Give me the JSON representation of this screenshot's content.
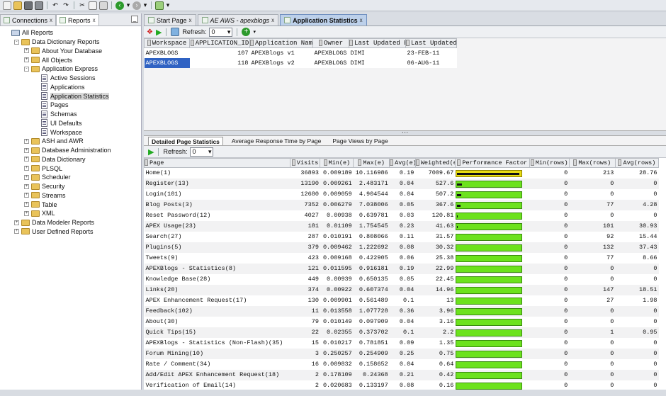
{
  "left_panel": {
    "tabs": [
      {
        "label": "Connections",
        "close": "x"
      },
      {
        "label": "Reports",
        "close": "x"
      }
    ],
    "minimize": "_",
    "tree": [
      {
        "label": "All Reports",
        "level": 0,
        "icon": "report-folder-icon",
        "expander": ""
      },
      {
        "label": "Data Dictionary Reports",
        "level": 1,
        "icon": "folder-icon",
        "expander": "-"
      },
      {
        "label": "About Your Database",
        "level": 2,
        "icon": "folder-icon",
        "expander": "+"
      },
      {
        "label": "All Objects",
        "level": 2,
        "icon": "folder-icon",
        "expander": "+"
      },
      {
        "label": "Application Express",
        "level": 2,
        "icon": "folder-icon",
        "expander": "-"
      },
      {
        "label": "Active Sessions",
        "level": 3,
        "icon": "report-icon",
        "expander": ""
      },
      {
        "label": "Applications",
        "level": 3,
        "icon": "report-icon",
        "expander": ""
      },
      {
        "label": "Application Statistics",
        "level": 3,
        "icon": "report-icon",
        "expander": "",
        "selected": true
      },
      {
        "label": "Pages",
        "level": 3,
        "icon": "report-icon",
        "expander": ""
      },
      {
        "label": "Schemas",
        "level": 3,
        "icon": "report-icon",
        "expander": ""
      },
      {
        "label": "UI Defaults",
        "level": 3,
        "icon": "report-icon",
        "expander": ""
      },
      {
        "label": "Workspace",
        "level": 3,
        "icon": "report-icon",
        "expander": ""
      },
      {
        "label": "ASH and AWR",
        "level": 2,
        "icon": "folder-icon",
        "expander": "+"
      },
      {
        "label": "Database Administration",
        "level": 2,
        "icon": "folder-icon",
        "expander": "+"
      },
      {
        "label": "Data Dictionary",
        "level": 2,
        "icon": "folder-icon",
        "expander": "+"
      },
      {
        "label": "PLSQL",
        "level": 2,
        "icon": "folder-icon",
        "expander": "+"
      },
      {
        "label": "Scheduler",
        "level": 2,
        "icon": "folder-icon",
        "expander": "+"
      },
      {
        "label": "Security",
        "level": 2,
        "icon": "folder-icon",
        "expander": "+"
      },
      {
        "label": "Streams",
        "level": 2,
        "icon": "folder-icon",
        "expander": "+"
      },
      {
        "label": "Table",
        "level": 2,
        "icon": "folder-icon",
        "expander": "+"
      },
      {
        "label": "XML",
        "level": 2,
        "icon": "folder-icon",
        "expander": "+"
      },
      {
        "label": "Data Modeler Reports",
        "level": 1,
        "icon": "folder-icon",
        "expander": "+"
      },
      {
        "label": "User Defined Reports",
        "level": 1,
        "icon": "folder-icon",
        "expander": "+"
      }
    ]
  },
  "editor": {
    "tabs": [
      {
        "label": "Start Page",
        "close": "x"
      },
      {
        "label": "AE AWS - apexblogs",
        "close": "x"
      },
      {
        "label": "Application Statistics",
        "close": "x",
        "selected": true
      }
    ],
    "refresh_label": "Refresh:",
    "refresh_value": "0",
    "apps_table": {
      "columns": [
        "Workspace",
        "APPLICATION_ID",
        "Application Name",
        "Owner",
        "Last Updated By",
        "Last Updated"
      ],
      "rows": [
        [
          "APEXBLOGS",
          "107",
          "APEXBlogs v1",
          "APEXBLOGS",
          "DIMI",
          "23-FEB-11"
        ],
        [
          "APEXBLOGS",
          "118",
          "APEXBlogs v2",
          "APEXBLOGS",
          "DIMI",
          "06-AUG-11"
        ]
      ]
    },
    "subtabs": [
      "Detailed Page Statistics",
      "Average Response Time by Page",
      "Page Views by Page"
    ],
    "detail_refresh_label": "Refresh:",
    "detail_refresh_value": "0",
    "detail_table": {
      "columns": [
        "Page",
        "Visits",
        "Min(e)",
        "Max(e)",
        "Avg(e)",
        "Weighted(e)",
        "Performance Factor",
        "Min(rows)",
        "Max(rows)",
        "Avg(rows)"
      ],
      "rows": [
        [
          "Home(1)",
          "36893",
          "0.009189",
          "10.116986",
          "0.19",
          "7009.67",
          1.0,
          "0",
          "213",
          "28.76"
        ],
        [
          "Register(13)",
          "13190",
          "0.009261",
          "2.483171",
          "0.04",
          "527.6",
          0.075,
          "0",
          "0",
          "0"
        ],
        [
          "Login(101)",
          "12680",
          "0.009059",
          "4.904544",
          "0.04",
          "507.2",
          0.072,
          "0",
          "0",
          "0"
        ],
        [
          "Blog Posts(3)",
          "7352",
          "0.006279",
          "7.038006",
          "0.05",
          "367.6",
          0.052,
          "0",
          "77",
          "4.28"
        ],
        [
          "Reset Password(12)",
          "4027",
          "0.00938",
          "0.639781",
          "0.03",
          "120.81",
          0.017,
          "0",
          "0",
          "0"
        ],
        [
          "APEX Usage(23)",
          "181",
          "0.01109",
          "1.754545",
          "0.23",
          "41.63",
          0.006,
          "0",
          "101",
          "30.93"
        ],
        [
          "Search(27)",
          "287",
          "0.010191",
          "0.808066",
          "0.11",
          "31.57",
          0.0045,
          "0",
          "92",
          "15.44"
        ],
        [
          "Plugins(5)",
          "379",
          "0.009462",
          "1.222692",
          "0.08",
          "30.32",
          0.0043,
          "0",
          "132",
          "37.43"
        ],
        [
          "Tweets(9)",
          "423",
          "0.009168",
          "0.422905",
          "0.06",
          "25.38",
          0.0036,
          "0",
          "77",
          "8.66"
        ],
        [
          "APEXBlogs - Statistics(8)",
          "121",
          "0.011595",
          "0.916181",
          "0.19",
          "22.99",
          0.0033,
          "0",
          "0",
          "0"
        ],
        [
          "Knowledge Base(28)",
          "449",
          "0.00939",
          "0.650135",
          "0.05",
          "22.45",
          0.0032,
          "0",
          "0",
          "0"
        ],
        [
          "Links(20)",
          "374",
          "0.00922",
          "0.607374",
          "0.04",
          "14.96",
          0.0021,
          "0",
          "147",
          "18.51"
        ],
        [
          "APEX Enhancement Request(17)",
          "130",
          "0.009901",
          "0.561489",
          "0.1",
          "13",
          0.0019,
          "0",
          "27",
          "1.98"
        ],
        [
          "Feedback(102)",
          "11",
          "0.013558",
          "1.077728",
          "0.36",
          "3.96",
          0.0006,
          "0",
          "0",
          "0"
        ],
        [
          "About(30)",
          "79",
          "0.010149",
          "0.097909",
          "0.04",
          "3.16",
          0.0005,
          "0",
          "0",
          "0"
        ],
        [
          "Quick Tips(15)",
          "22",
          "0.02355",
          "0.373702",
          "0.1",
          "2.2",
          0.0003,
          "0",
          "1",
          "0.95"
        ],
        [
          "APEXBlogs - Statistics (Non-Flash)(35)",
          "15",
          "0.010217",
          "0.781851",
          "0.09",
          "1.35",
          0.0002,
          "0",
          "0",
          "0"
        ],
        [
          "Forum Mining(10)",
          "3",
          "0.250257",
          "0.254909",
          "0.25",
          "0.75",
          0.0001,
          "0",
          "0",
          "0"
        ],
        [
          "Rate / Comment(34)",
          "16",
          "0.009832",
          "0.158652",
          "0.04",
          "0.64",
          0.0001,
          "0",
          "0",
          "0"
        ],
        [
          "Add/Edit APEX Enhancement Request(18)",
          "2",
          "0.178109",
          "0.24368",
          "0.21",
          "0.42",
          0.0001,
          "0",
          "0",
          "0"
        ],
        [
          "Verification of Email(14)",
          "2",
          "0.020683",
          "0.133197",
          "0.08",
          "0.16",
          0.0,
          "0",
          "0",
          "0"
        ]
      ]
    }
  },
  "colors": {
    "bar_green": "#6ce21d",
    "bar_top": "#e8dc10",
    "selected_row": "#2f62c3"
  }
}
